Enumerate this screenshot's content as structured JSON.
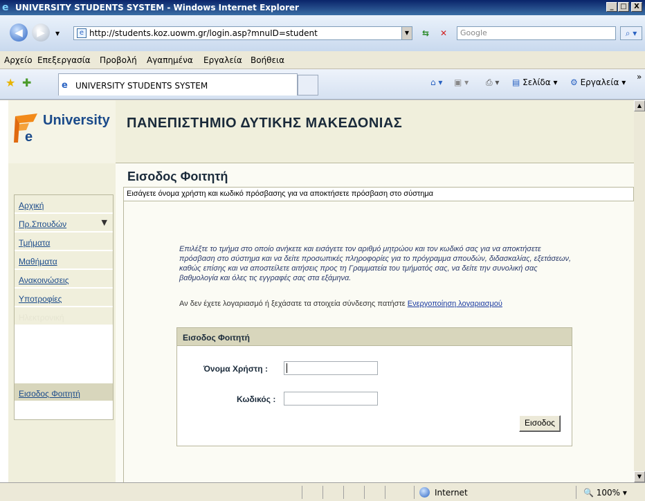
{
  "window": {
    "title": "UNIVERSITY STUDENTS SYSTEM - Windows Internet Explorer",
    "controls": {
      "minimize": "_",
      "maximize": "□",
      "close": "X"
    }
  },
  "address": {
    "url": "http://students.koz.uowm.gr/login.asp?mnuID=student",
    "search_placeholder": "Google"
  },
  "menu": [
    "Αρχείο",
    "Επεξεργασία",
    "Προβολή",
    "Αγαπημένα",
    "Εργαλεία",
    "Βοήθεια"
  ],
  "tab": {
    "label": "UNIVERSITY STUDENTS SYSTEM"
  },
  "commandbar": {
    "page": "Σελίδα",
    "tools": "Εργαλεία"
  },
  "site": {
    "logo_text": "University",
    "university_name": "ΠΑΝΕΠΙΣΤΗΜΙΟ ΔΥΤΙΚΗΣ ΜΑΚΕΔΟΝΙΑΣ",
    "page_heading": "Εισοδος Φοιτητή",
    "info_bar": "Εισάγετε όνομα χρήστη και κωδικό πρόσβασης για να αποκτήσετε πρόσβαση στο σύστημα",
    "intro_text": "Επιλέξτε το τμήμα στο οποίο ανήκετε και εισάγετε τον αριθμό μητρώου και τον κωδικό σας για να αποκτήσετε πρόσβαση στο σύστημα και να δείτε προσωπικές πληροφορίες για το πρόγραμμα σπουδών, διδασκαλίας, εξετάσεων, καθώς επίσης και να αποστείλετε αιτήσεις προς τη Γραμματεία του τμήματός σας, να δείτε την συνολική σας βαθμολογία και όλες τις εγγραφές σας στα εξάμηνα.",
    "activate_prefix": "Αν δεν έχετε λογαριασμό ή ξεχάσατε τα στοιχεία σύνδεσης πατήστε",
    "activate_link": "Ενεργοποίηση λογαριασμού"
  },
  "sidebar": {
    "items": [
      {
        "label": "Αρχική"
      },
      {
        "label": "Πρ.Σπουδών",
        "dropdown": "▼"
      },
      {
        "label": "Τμήματα"
      },
      {
        "label": "Μαθήματα"
      },
      {
        "label": "Ανακοινώσεις"
      },
      {
        "label": "Υποτροφίες"
      },
      {
        "label": "Ηλεκτρονική"
      }
    ],
    "active_item": "Εισοδος Φοιτητή"
  },
  "login": {
    "box_title": "Εισοδος Φοιτητή",
    "username_label": "Όνομα Χρήστη :",
    "password_label": "Κωδικός :",
    "submit_label": "Εισοδος"
  },
  "status": {
    "zone": "Internet",
    "zoom": "100%"
  }
}
